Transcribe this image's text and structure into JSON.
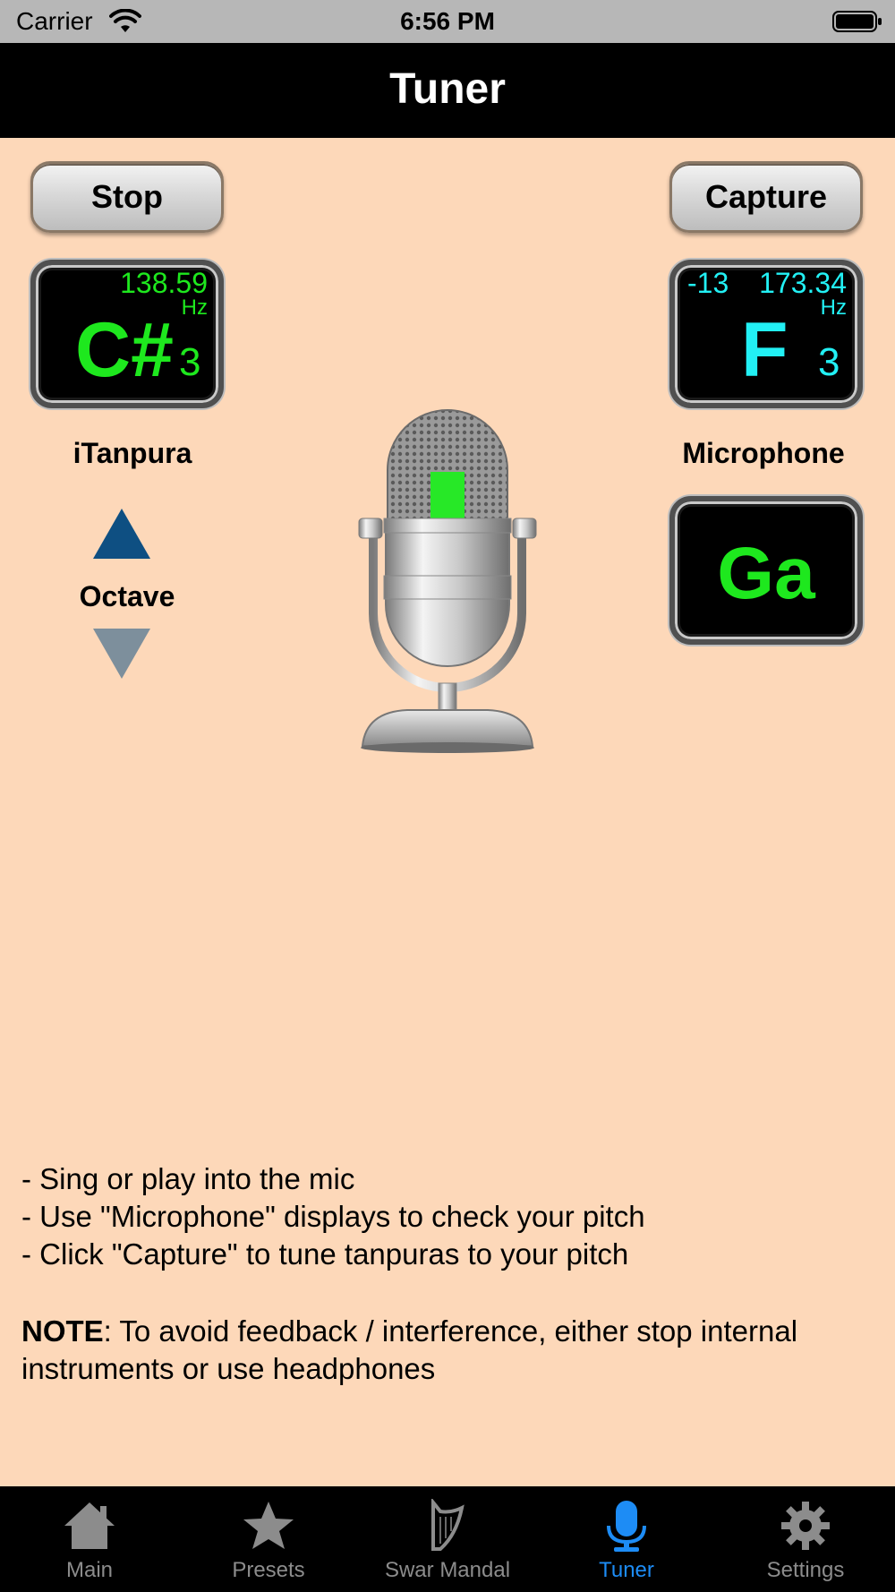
{
  "status_bar": {
    "carrier": "Carrier",
    "time": "6:56 PM",
    "wifi_icon": "wifi-icon",
    "battery_icon": "battery-icon"
  },
  "nav": {
    "title": "Tuner"
  },
  "buttons": {
    "stop_label": "Stop",
    "capture_label": "Capture"
  },
  "itanpura_display": {
    "frequency": "138.59",
    "hz_unit": "Hz",
    "note": "C#",
    "octave": "3",
    "color": "#1ee81e"
  },
  "microphone_display": {
    "cents": "-13",
    "frequency": "173.34",
    "hz_unit": "Hz",
    "note": "F",
    "octave": "3",
    "color": "#22f0f4"
  },
  "swar_display": {
    "note": "Ga",
    "color": "#1ee81e"
  },
  "labels": {
    "itanpura": "iTanpura",
    "microphone": "Microphone",
    "octave": "Octave"
  },
  "octave_controls": {
    "up_icon": "triangle-up-icon",
    "down_icon": "triangle-down-icon"
  },
  "mic_icon": "microphone-icon",
  "instructions": [
    "- Sing or play into the mic",
    "- Use \"Microphone\" displays to check your pitch",
    "- Click \"Capture\" to tune tanpuras to your pitch"
  ],
  "note": {
    "bold": "NOTE",
    "text": ": To avoid feedback / interference, either stop internal instruments or use headphones"
  },
  "tabs": [
    {
      "label": "Main",
      "icon": "home-icon",
      "active": false
    },
    {
      "label": "Presets",
      "icon": "star-icon",
      "active": false
    },
    {
      "label": "Swar Mandal",
      "icon": "harp-icon",
      "active": false
    },
    {
      "label": "Tuner",
      "icon": "microphone-icon",
      "active": true
    },
    {
      "label": "Settings",
      "icon": "gear-icon",
      "active": false
    }
  ],
  "colors": {
    "background": "#fdd8b9",
    "tab_active": "#1d8cf5",
    "tab_inactive": "#8c8c8c",
    "octave_up": "#0e4f82",
    "octave_down": "#7d8f9c"
  }
}
